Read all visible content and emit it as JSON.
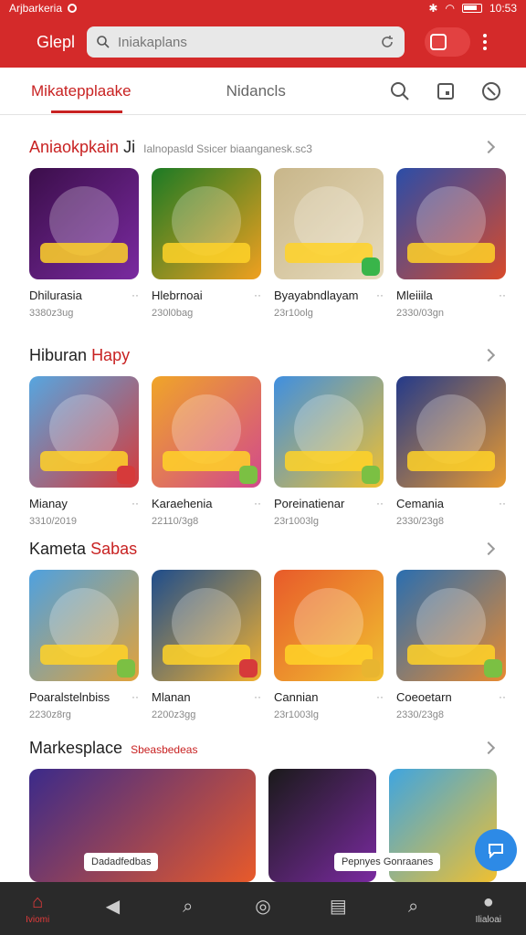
{
  "status": {
    "carrier": "Arjbarkeria",
    "time": "10:53"
  },
  "app": {
    "title": "Glepl",
    "search_placeholder": "Iniakaplans"
  },
  "tabs": [
    {
      "label": "Mikatepplaake"
    },
    {
      "label": "Nidancls"
    }
  ],
  "sections": [
    {
      "title": "Aniaokpkain",
      "title_accent": "Ji",
      "subtitle": "Ialnopasld Ssicer biaanganesk.sc3",
      "items": [
        {
          "name": "Dhilurasia",
          "meta": "3380z3ug",
          "colors": [
            "#3b0e4a",
            "#7a2aa0"
          ],
          "badge": ""
        },
        {
          "name": "Hlebrnoai",
          "meta": "230l0bag",
          "colors": [
            "#1b7a24",
            "#f0a020"
          ],
          "badge": ""
        },
        {
          "name": "Byayabndlayam",
          "meta": "23r10olg",
          "colors": [
            "#c8b68a",
            "#e7dbbd"
          ],
          "badge": "#39b54a"
        },
        {
          "name": "Mleiiila",
          "meta": "2330/03gn",
          "colors": [
            "#2b4da8",
            "#d84a2b"
          ],
          "badge": ""
        }
      ]
    },
    {
      "title": "Hiburan",
      "title_accent": "Hapy",
      "subtitle": "",
      "items": [
        {
          "name": "Mianay",
          "meta": "3310/2019",
          "colors": [
            "#56a6e0",
            "#d63a3a"
          ],
          "badge": "#d63a3a"
        },
        {
          "name": "Karaehenia",
          "meta": "22110/3g8",
          "colors": [
            "#f0a528",
            "#d2498c"
          ],
          "badge": "#7bc043"
        },
        {
          "name": "Poreinatienar",
          "meta": "23r1003lg",
          "colors": [
            "#3f8fe0",
            "#f0c030"
          ],
          "badge": "#7bc043"
        },
        {
          "name": "Cemania",
          "meta": "2330/23g8",
          "colors": [
            "#243a8a",
            "#e89a30"
          ],
          "badge": ""
        }
      ]
    },
    {
      "title": "Kameta",
      "title_accent": "Sabas",
      "subtitle": "",
      "items": [
        {
          "name": "Poaralstelnbiss",
          "meta": "2230z8rg",
          "colors": [
            "#4ea1e0",
            "#e2a23a"
          ],
          "badge": "#7bc043"
        },
        {
          "name": "Mlanan",
          "meta": "2200z3gg",
          "colors": [
            "#1e4d8c",
            "#f0b030"
          ],
          "badge": "#d63a3a"
        },
        {
          "name": "Cannian",
          "meta": "23r1003lg",
          "colors": [
            "#e85a2a",
            "#f0c030"
          ],
          "badge": "#e8b530"
        },
        {
          "name": "Coeoetarn",
          "meta": "2330/23g8",
          "colors": [
            "#2a6eb0",
            "#e88a30"
          ],
          "badge": "#7bc043"
        }
      ]
    },
    {
      "title": "Markesplace",
      "title_accent": "Sbeasbedeas",
      "subtitle": "",
      "banner": {
        "label": "Dadadfedbas",
        "colors": [
          "#3b2a8a",
          "#e85a2a"
        ]
      },
      "items": [
        {
          "name": "",
          "meta": "",
          "colors": [
            "#1a1a1a",
            "#7a2aa0"
          ],
          "badge": ""
        },
        {
          "name": "",
          "meta": "",
          "colors": [
            "#3fa5e0",
            "#f0c030"
          ],
          "badge": "",
          "pill": "Pepnyes Gonraanes"
        }
      ]
    }
  ],
  "nav": [
    {
      "label": "Iviomi",
      "icon": "home-icon",
      "glyph": "⌂"
    },
    {
      "label": "",
      "icon": "play-back-icon",
      "glyph": "◀"
    },
    {
      "label": "",
      "icon": "search-icon",
      "glyph": "⌕"
    },
    {
      "label": "",
      "icon": "compass-icon",
      "glyph": "◎"
    },
    {
      "label": "",
      "icon": "book-icon",
      "glyph": "▤"
    },
    {
      "label": "",
      "icon": "search-icon-2",
      "glyph": "⌕"
    },
    {
      "label": "Ilialoai",
      "icon": "profile-icon",
      "glyph": "●"
    }
  ],
  "colors": {
    "brand": "#d42a2a",
    "accent": "#c82222",
    "nav_bg": "#2a2a2a",
    "fab": "#2d8ae6"
  }
}
